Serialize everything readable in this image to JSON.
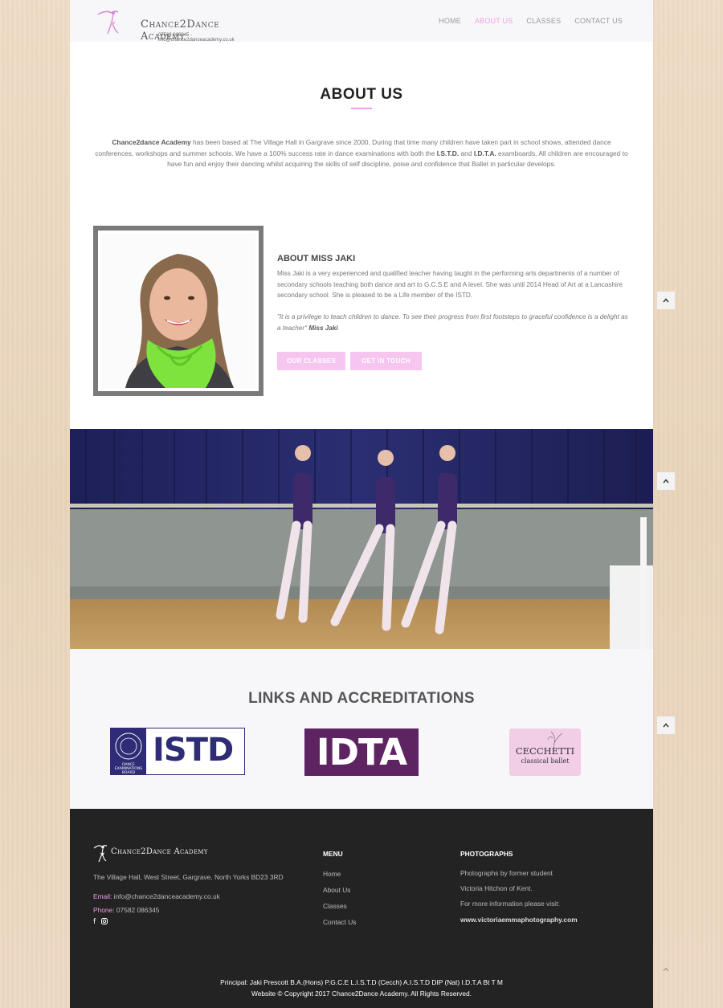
{
  "header": {
    "logo_title": "Chance2Dance Academy",
    "logo_sub": "07582 086345 - info@chance2danceacademy.co.uk",
    "nav": [
      {
        "label": "HOME",
        "active": false
      },
      {
        "label": "ABOUT US",
        "active": true
      },
      {
        "label": "CLASSES",
        "active": false
      },
      {
        "label": "CONTACT US",
        "active": false
      }
    ]
  },
  "about": {
    "title": "ABOUT US",
    "p_brand": "Chance2dance Academy",
    "p_1": " has been based at The Village Hall in Gargrave since 2000. During that time many children have taken part in school shows, attended dance conferences, workshops and summer schools. We have a 100% success rate in dance examinations with both the ",
    "p_istd": "I.S.T.D.",
    "p_and": " and ",
    "p_idta": "I.D.T.A.",
    "p_2": " examboards. All children are encouraged to have fun and enjoy their dancing whilst acquiring the skills of self discipline, poise and confidence that Ballet in particular develops."
  },
  "jaki": {
    "heading": "ABOUT MISS JAKI",
    "bio": "Miss Jaki is a very experienced and qualified teacher having taught in the performing arts departments of a number of secondary schools teaching both dance and art to G.C.S.E and A level. She was until 2014 Head of Art at a Lancashire secondary school. She is pleased to be a Life member of the ISTD.",
    "quote": "\"It is a privilege to teach children to dance. To see their progress from first footsteps to graceful confidence is a delight as a teacher\"",
    "quote_author": "Miss Jaki",
    "btn_classes": "OUR CLASSES",
    "btn_touch": "GET IN TOUCH"
  },
  "links": {
    "title": "LINKS AND ACCREDITATIONS",
    "istd": "ISTD",
    "istd_sub": "DANCE EXAMINATIONS BOARD",
    "idta": "IDTA",
    "cecchetti_title": "CECCHETTI",
    "cecchetti_sub": "classical ballet"
  },
  "footer": {
    "logo_text": "Chance2Dance Academy",
    "address": "The Village Hall, West Street, Gargrave, North Yorks BD23 3RD",
    "email_label": "Email:",
    "email": "info@chance2danceacademy.co.uk",
    "phone_label": "Phone:",
    "phone": "07582 086345",
    "menu_heading": "MENU",
    "menu": [
      "Home",
      "About Us",
      "Classes",
      "Contact Us"
    ],
    "photos_heading": "PHOTOGRAPHS",
    "photos_line1": "Photographs by former student",
    "photos_line2": "Victoria Hitchon of Kent.",
    "photos_line3": "For more information please visit:",
    "photos_link": "www.victoriaemmaphotography.com",
    "credit_1": "Principal: Jaki Prescott B.A.(Hons) P.G.C.E L.I.S.T.D (Cecch) A.I.S.T.D DIP (Nat) I.D.T.A Bt T M",
    "credit_2": "Website © Copyright 2017 Chance2Dance Academy. All Rights Reserved."
  },
  "colors": {
    "accent": "#ee9ee6",
    "button": "#f7c6f0",
    "footer_bg": "#232323",
    "istd_blue": "#2e2c76",
    "idta_purple": "#5d2461"
  }
}
